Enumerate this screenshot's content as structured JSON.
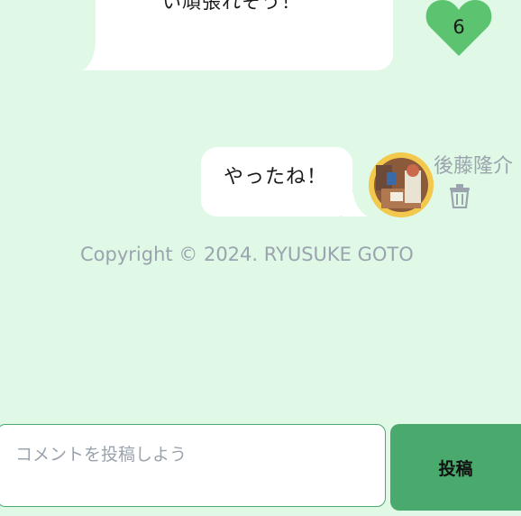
{
  "messages": [
    {
      "text": "い頑張れそう！",
      "likes": "6"
    },
    {
      "text": "やったね！",
      "author": "後藤隆介"
    }
  ],
  "footer": {
    "copyright": "Copyright © 2024. RYUSUKE GOTO"
  },
  "composer": {
    "placeholder": "コメントを投稿しよう",
    "submit_label": "投稿"
  },
  "colors": {
    "background": "#e0f9e6",
    "accent": "#4aa96c",
    "heart": "#5cc470",
    "muted_text": "#9aa3ae"
  },
  "icons": [
    "heart-icon",
    "trash-icon",
    "avatar"
  ]
}
